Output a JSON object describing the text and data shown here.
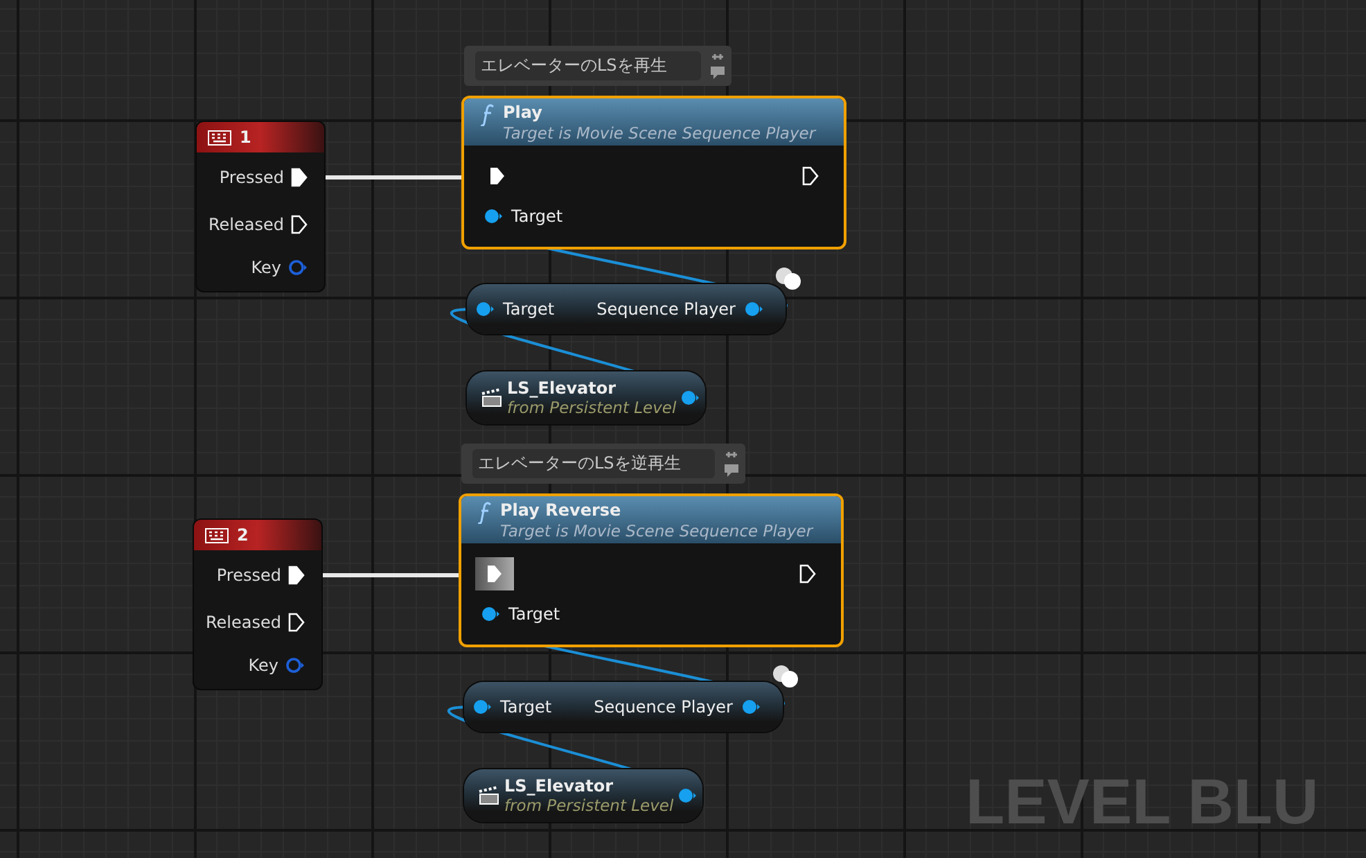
{
  "graph": {
    "groups": [
      {
        "comment": "エレベーターのLSを再生",
        "event": {
          "key": "1",
          "pins": [
            {
              "label": "Pressed",
              "kind": "exec",
              "connected": true
            },
            {
              "label": "Released",
              "kind": "exec",
              "connected": false
            },
            {
              "label": "Key",
              "kind": "data",
              "connected": false
            }
          ]
        },
        "function": {
          "name": "Play",
          "subtitle": "Target is Movie Scene Sequence Player",
          "selected": true,
          "exec_in_hovered": false,
          "target": "Target"
        },
        "getter": {
          "input": "Target",
          "output": "Sequence Player"
        },
        "reference": {
          "name": "LS_Elevator",
          "subtitle": "from Persistent Level"
        }
      },
      {
        "comment": "エレベーターのLSを逆再生",
        "event": {
          "key": "2",
          "pins": [
            {
              "label": "Pressed",
              "kind": "exec",
              "connected": true
            },
            {
              "label": "Released",
              "kind": "exec",
              "connected": false
            },
            {
              "label": "Key",
              "kind": "data",
              "connected": false
            }
          ]
        },
        "function": {
          "name": "Play Reverse",
          "subtitle": "Target is Movie Scene Sequence Player",
          "selected": true,
          "exec_in_hovered": true,
          "target": "Target"
        },
        "getter": {
          "input": "Target",
          "output": "Sequence Player"
        },
        "reference": {
          "name": "LS_Elevator",
          "subtitle": "from Persistent Level"
        }
      }
    ],
    "watermark": "LEVEL BLU"
  }
}
